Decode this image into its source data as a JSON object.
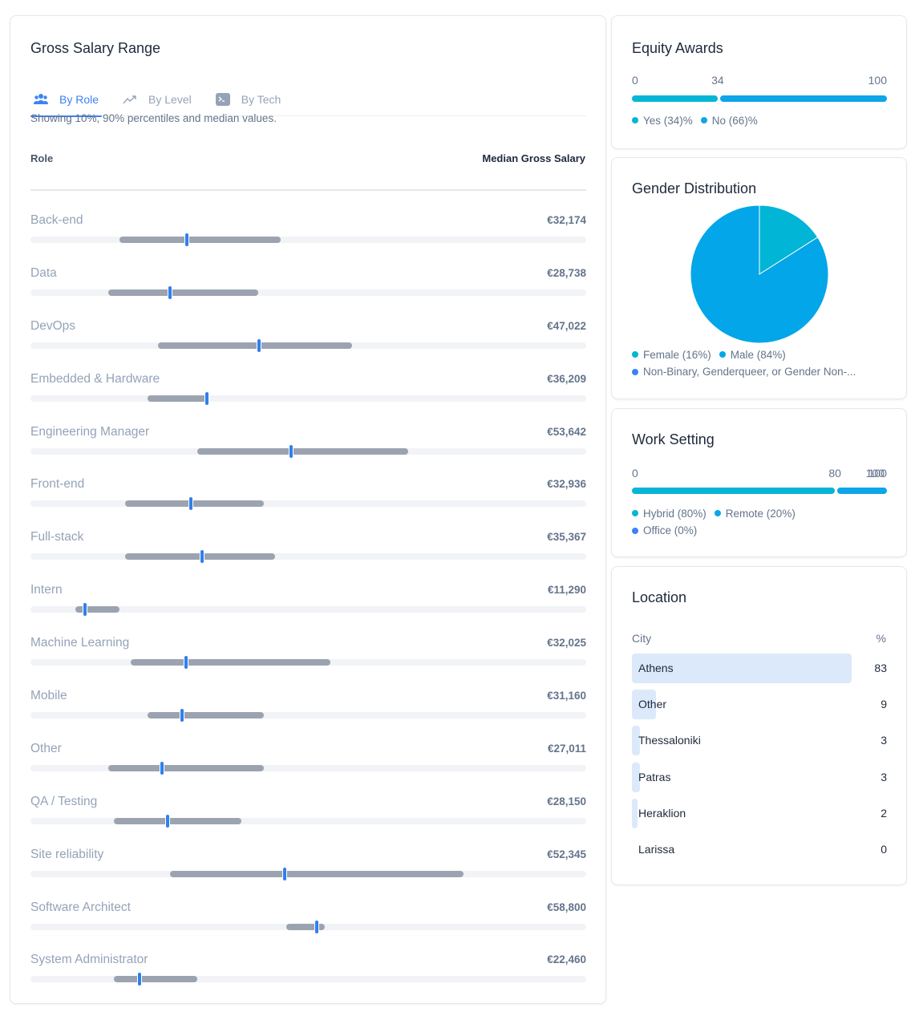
{
  "salary": {
    "title": "Gross Salary Range",
    "tabs": [
      {
        "label": "By Role",
        "icon": "users-icon",
        "active": true
      },
      {
        "label": "By Level",
        "icon": "trending-up-icon",
        "active": false
      },
      {
        "label": "By Tech",
        "icon": "terminal-icon",
        "active": false
      }
    ],
    "subtitle": "Showing 10%, 90% percentiles and median values.",
    "col_role": "Role",
    "col_median": "Median Gross Salary",
    "scale_max": 114300,
    "rows": [
      {
        "role": "Back-end",
        "median_label": "€32,174",
        "median": 32174,
        "p10": 18300,
        "p90": 51500
      },
      {
        "role": "Data",
        "median_label": "€28,738",
        "median": 28738,
        "p10": 16000,
        "p90": 46900
      },
      {
        "role": "DevOps",
        "median_label": "€47,022",
        "median": 47022,
        "p10": 26200,
        "p90": 66200
      },
      {
        "role": "Embedded & Hardware",
        "median_label": "€36,209",
        "median": 36209,
        "p10": 24100,
        "p90": 36600
      },
      {
        "role": "Engineering Manager",
        "median_label": "€53,642",
        "median": 53642,
        "p10": 34300,
        "p90": 77700
      },
      {
        "role": "Front-end",
        "median_label": "€32,936",
        "median": 32936,
        "p10": 19500,
        "p90": 48000
      },
      {
        "role": "Full-stack",
        "median_label": "€35,367",
        "median": 35367,
        "p10": 19500,
        "p90": 50300
      },
      {
        "role": "Intern",
        "median_label": "€11,290",
        "median": 11290,
        "p10": 9200,
        "p90": 18300
      },
      {
        "role": "Machine Learning",
        "median_label": "€32,025",
        "median": 32025,
        "p10": 20600,
        "p90": 61700
      },
      {
        "role": "Mobile",
        "median_label": "€31,160",
        "median": 31160,
        "p10": 24100,
        "p90": 48000
      },
      {
        "role": "Other",
        "median_label": "€27,011",
        "median": 27011,
        "p10": 16000,
        "p90": 48000
      },
      {
        "role": "QA / Testing",
        "median_label": "€28,150",
        "median": 28150,
        "p10": 17200,
        "p90": 43400
      },
      {
        "role": "Site reliability",
        "median_label": "€52,345",
        "median": 52345,
        "p10": 28700,
        "p90": 89100
      },
      {
        "role": "Software Architect",
        "median_label": "€58,800",
        "median": 58800,
        "p10": 52600,
        "p90": 60600
      },
      {
        "role": "System Administrator",
        "median_label": "€22,460",
        "median": 22460,
        "p10": 17200,
        "p90": 34300
      }
    ]
  },
  "equity": {
    "title": "Equity Awards",
    "ticks": [
      "0",
      "34",
      "100"
    ],
    "segments": [
      {
        "name": "Yes",
        "value": 34,
        "color": "#06b6d4",
        "legend": "Yes (34)%"
      },
      {
        "name": "No",
        "value": 66,
        "color": "#0ea5e9",
        "legend": "No (66)%"
      }
    ]
  },
  "gender": {
    "title": "Gender Distribution",
    "slices": [
      {
        "name": "Female",
        "value": 16,
        "color": "#00b5d6",
        "legend": "Female (16%)"
      },
      {
        "name": "Male",
        "value": 84,
        "color": "#03a6e8",
        "legend": "Male (84%)"
      },
      {
        "name": "Non-Binary",
        "value": 0,
        "color": "#3b82f6",
        "legend": "Non-Binary, Genderqueer, or Gender Non-..."
      }
    ]
  },
  "work": {
    "title": "Work Setting",
    "ticks": [
      "0",
      "80",
      "100",
      "100"
    ],
    "segments": [
      {
        "name": "Hybrid",
        "value": 80,
        "color": "#06b6d4",
        "legend": "Hybrid (80%)"
      },
      {
        "name": "Remote",
        "value": 20,
        "color": "#0ea5e9",
        "legend": "Remote (20%)"
      },
      {
        "name": "Office",
        "value": 0,
        "color": "#3b82f6",
        "legend": "Office (0%)"
      }
    ]
  },
  "location": {
    "title": "Location",
    "col_city": "City",
    "col_pct": "%",
    "rows": [
      {
        "city": "Athens",
        "pct": 83,
        "pct_label": "83"
      },
      {
        "city": "Other",
        "pct": 9,
        "pct_label": "9"
      },
      {
        "city": "Thessaloniki",
        "pct": 3,
        "pct_label": "3"
      },
      {
        "city": "Patras",
        "pct": 3,
        "pct_label": "3"
      },
      {
        "city": "Heraklion",
        "pct": 2,
        "pct_label": "2"
      },
      {
        "city": "Larissa",
        "pct": 0,
        "pct_label": "0"
      }
    ]
  }
}
